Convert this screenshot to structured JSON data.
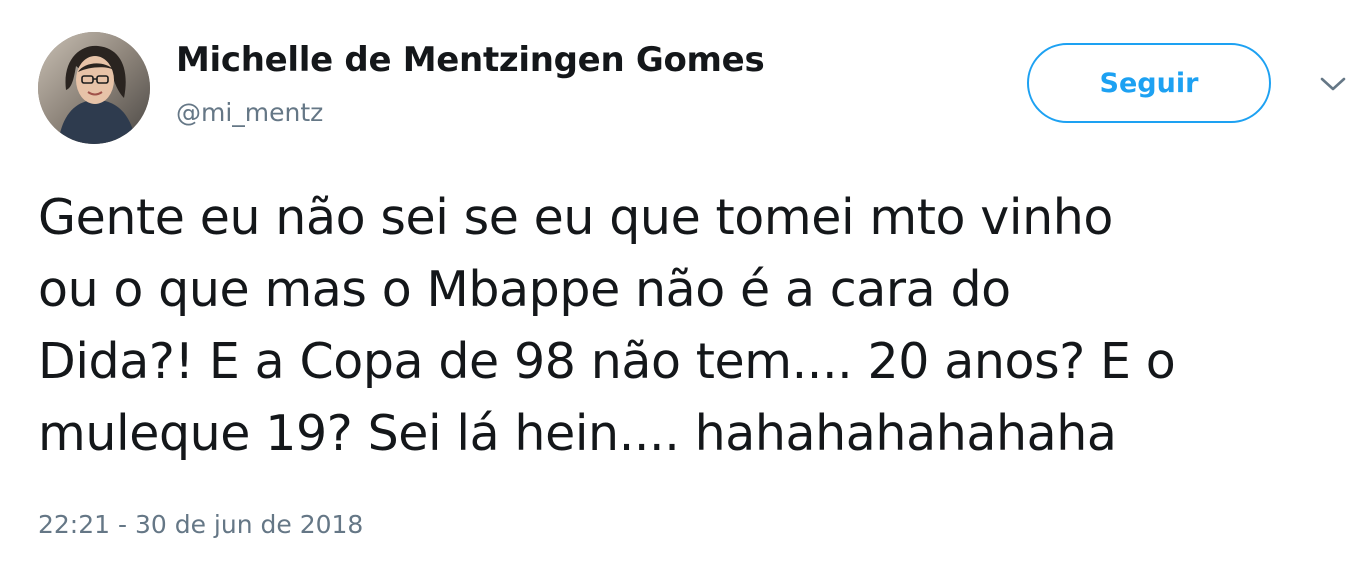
{
  "author": {
    "name": "Michelle de Mentzingen Gomes",
    "handle": "@mi_mentz",
    "avatar_icon": "profile-photo"
  },
  "follow_button": {
    "label": "Seguir",
    "color": "#1da1f2"
  },
  "menu": {
    "caret_icon": "chevron-down-icon"
  },
  "tweet": {
    "lines": [
      "Gente eu não sei se eu que tomei mto vinho",
      "ou o que mas o Mbappe não é a cara do",
      "Dida?! E a Copa de 98 não tem.... 20 anos? E o",
      "muleque 19? Sei lá hein.... hahahahahahaha"
    ],
    "timestamp": "22:21 - 30 de jun de 2018"
  },
  "colors": {
    "text": "#14171a",
    "secondary_text": "#657786",
    "accent": "#1da1f2"
  }
}
